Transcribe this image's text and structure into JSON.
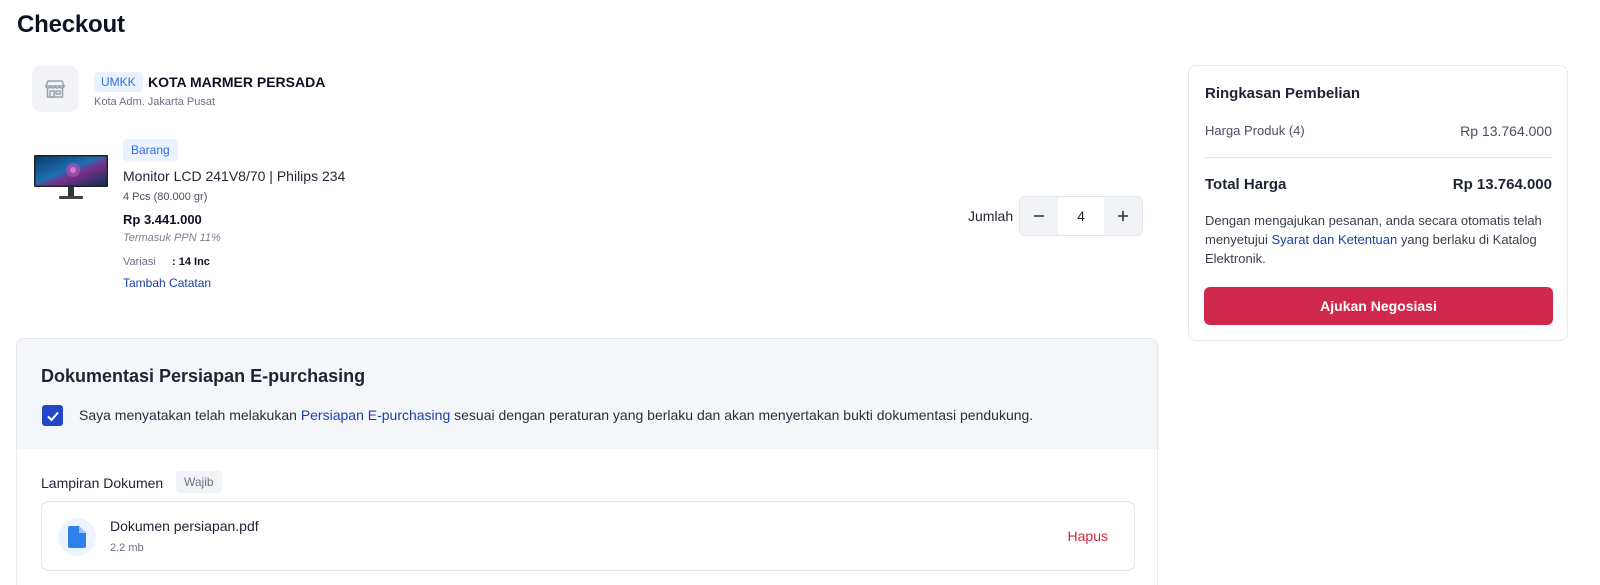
{
  "page": {
    "title": "Checkout"
  },
  "colors": {
    "accent": "#1d3fa6",
    "primary_button": "#d0284c",
    "badge_bg": "#eaf2ff",
    "badge_text": "#2f6fe0"
  },
  "seller": {
    "icon": "store-icon",
    "badge": "UMKK",
    "name": "KOTA MARMER PERSADA",
    "location": "Kota Adm. Jakarta Pusat"
  },
  "product": {
    "type_badge": "Barang",
    "name": "Monitor LCD 241V8/70 | Philips 234",
    "qty_weight": "4 Pcs (80.000 gr)",
    "price": "Rp 3.441.000",
    "tax_note": "Termasuk PPN 11%",
    "variant_label": "Variasi",
    "variant_value": ": 14 Inc",
    "add_note": "Tambah Catatan",
    "quantity_label": "Jumlah",
    "quantity": "4",
    "minus_icon": "minus-icon",
    "plus_icon": "plus-icon"
  },
  "documentation": {
    "title": "Dokumentasi Persiapan E-purchasing",
    "checked": true,
    "statement_before": "Saya menyatakan telah melakukan ",
    "statement_link": "Persiapan E-purchasing",
    "statement_after": " sesuai dengan peraturan yang berlaku dan akan menyertakan bukti dokumentasi pendukung.",
    "attachment_label": "Lampiran Dokumen",
    "required_badge": "Wajib",
    "file": {
      "icon": "file-icon",
      "name": "Dokumen persiapan.pdf",
      "size": "2.2 mb",
      "delete": "Hapus"
    }
  },
  "summary": {
    "title": "Ringkasan Pembelian",
    "product_price_label": "Harga Produk (4)",
    "product_price_value": "Rp 13.764.000",
    "total_label": "Total Harga",
    "total_value": "Rp 13.764.000",
    "terms_before": "Dengan mengajukan pesanan, anda secara otomatis telah menyetujui ",
    "terms_link": "Syarat dan Ketentuan",
    "terms_after": " yang berlaku di Katalog Elektronik.",
    "submit": "Ajukan Negosiasi"
  }
}
